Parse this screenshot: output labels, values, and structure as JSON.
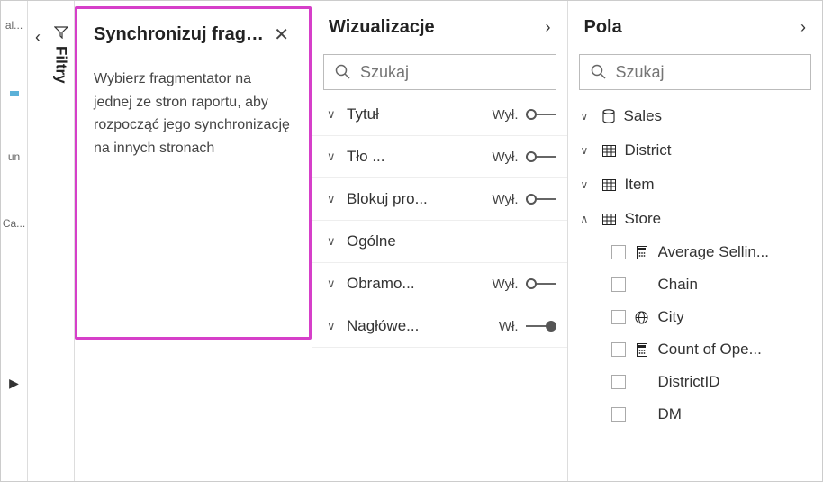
{
  "edge": {
    "label1": "al...",
    "label2": "un",
    "label3": "Ca..."
  },
  "filters": {
    "label": "Filtry"
  },
  "sync": {
    "title": "Synchronizuj frag…",
    "body": "Wybierz fragmentator na jednej ze stron raportu, aby rozpocząć jego synchronizację na innych stronach"
  },
  "viz": {
    "title": "Wizualizacje",
    "search_placeholder": "Szukaj",
    "state_off": "Wył.",
    "state_on": "Wł.",
    "rows": [
      {
        "label": "Tytuł",
        "state": "off"
      },
      {
        "label": "Tło ...",
        "state": "off"
      },
      {
        "label": "Blokuj pro...",
        "state": "off"
      },
      {
        "label": "Ogólne",
        "state": null
      },
      {
        "label": "Obramo...",
        "state": "off"
      },
      {
        "label": "Nagłówe...",
        "state": "on"
      }
    ]
  },
  "fields": {
    "title": "Pola",
    "search_placeholder": "Szukaj",
    "tables": [
      {
        "name": "Sales",
        "expanded": false,
        "icon": "db"
      },
      {
        "name": "District",
        "expanded": false,
        "icon": "table"
      },
      {
        "name": "Item",
        "expanded": false,
        "icon": "table"
      },
      {
        "name": "Store",
        "expanded": true,
        "icon": "table",
        "fields": [
          {
            "name": "Average Sellin...",
            "icon": "calc"
          },
          {
            "name": "Chain",
            "icon": ""
          },
          {
            "name": "City",
            "icon": "globe"
          },
          {
            "name": "Count of Ope...",
            "icon": "calc"
          },
          {
            "name": "DistrictID",
            "icon": ""
          },
          {
            "name": "DM",
            "icon": ""
          }
        ]
      }
    ]
  }
}
